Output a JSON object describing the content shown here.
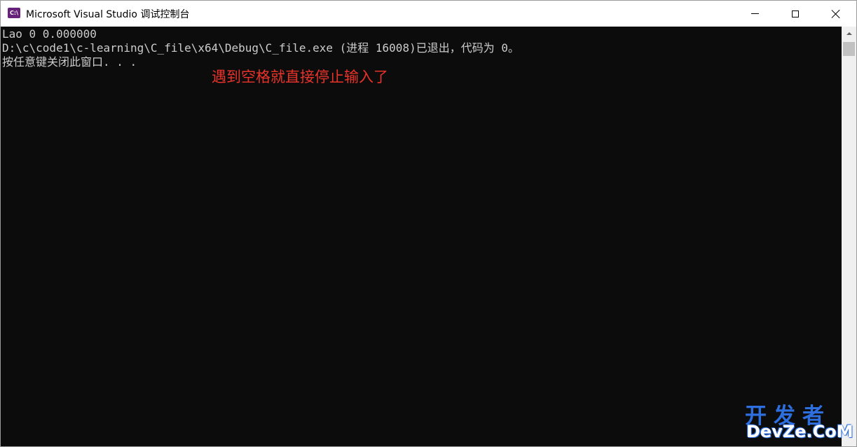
{
  "window": {
    "title": "Microsoft Visual Studio 调试控制台",
    "app_icon_label": "C:\\",
    "app_icon_color": "#68217a"
  },
  "controls": {
    "minimize": "minimize",
    "maximize": "maximize",
    "close": "close"
  },
  "console": {
    "background": "#0c0c0c",
    "text_color": "#cccccc",
    "lines": [
      "Lao 0 0.000000",
      "D:\\c\\code1\\c-learning\\C_file\\x64\\Debug\\C_file.exe (进程 16008)已退出，代码为 0。",
      "按任意键关闭此窗口. . ."
    ]
  },
  "annotation": {
    "text": "遇到空格就直接停止输入了",
    "color": "#e8332a"
  },
  "watermark": {
    "top": "开发者",
    "bottom": "DevZe.CoM"
  }
}
